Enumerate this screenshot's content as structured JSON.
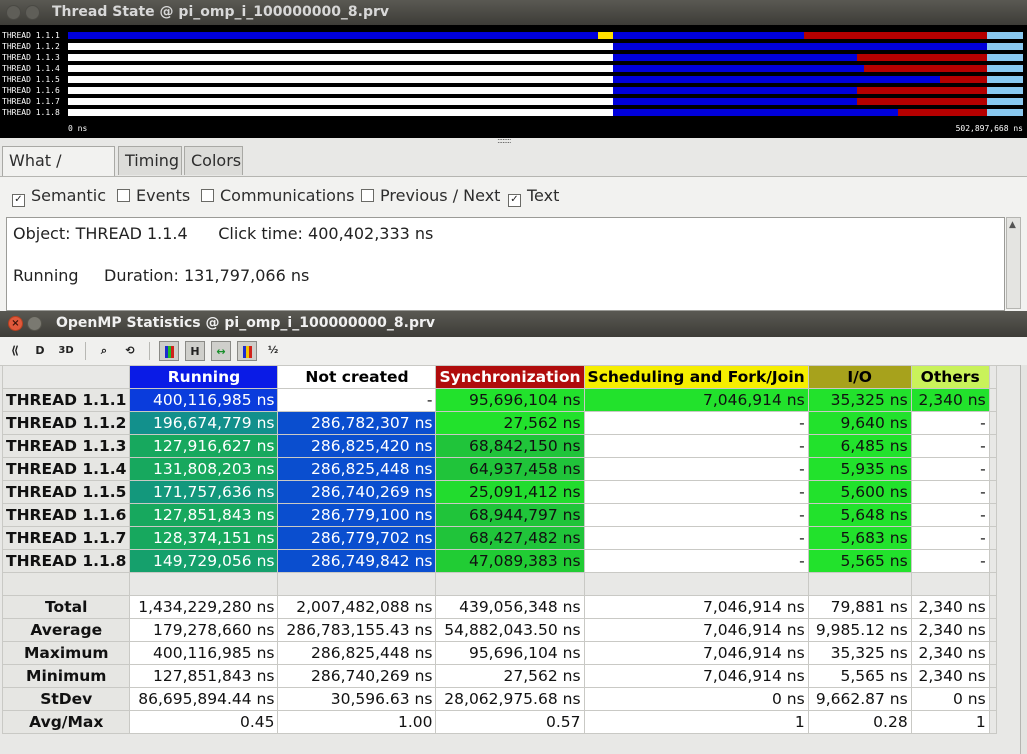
{
  "timeline_window": {
    "title": "Thread State @ pi_omp_i_100000000_8.prv",
    "rows": [
      {
        "label": "THREAD 1.1.1",
        "segments": [
          {
            "from": 0,
            "to": 0.5545,
            "color": "#0000dc"
          },
          {
            "from": 0.5545,
            "to": 0.5705,
            "color": "#ffe000"
          },
          {
            "from": 0.5705,
            "to": 0.7705,
            "color": "#0000dc"
          },
          {
            "from": 0.7705,
            "to": 0.962,
            "color": "#b50000"
          },
          {
            "from": 0.962,
            "to": 1,
            "color": "#89c8f0"
          }
        ]
      },
      {
        "label": "THREAD 1.1.2",
        "segments": [
          {
            "from": 0,
            "to": 0.5705,
            "color": "#ffffff"
          },
          {
            "from": 0.5705,
            "to": 0.962,
            "color": "#0000dc"
          },
          {
            "from": 0.962,
            "to": 1,
            "color": "#89c8f0"
          }
        ]
      },
      {
        "label": "THREAD 1.1.3",
        "segments": [
          {
            "from": 0,
            "to": 0.5705,
            "color": "#ffffff"
          },
          {
            "from": 0.5705,
            "to": 0.826,
            "color": "#0000dc"
          },
          {
            "from": 0.826,
            "to": 0.962,
            "color": "#b50000"
          },
          {
            "from": 0.962,
            "to": 1,
            "color": "#89c8f0"
          }
        ]
      },
      {
        "label": "THREAD 1.1.4",
        "segments": [
          {
            "from": 0,
            "to": 0.5705,
            "color": "#ffffff"
          },
          {
            "from": 0.5705,
            "to": 0.833,
            "color": "#0000dc"
          },
          {
            "from": 0.833,
            "to": 0.962,
            "color": "#b50000"
          },
          {
            "from": 0.962,
            "to": 1,
            "color": "#89c8f0"
          }
        ]
      },
      {
        "label": "THREAD 1.1.5",
        "segments": [
          {
            "from": 0,
            "to": 0.5705,
            "color": "#ffffff"
          },
          {
            "from": 0.5705,
            "to": 0.913,
            "color": "#0000dc"
          },
          {
            "from": 0.913,
            "to": 0.962,
            "color": "#b50000"
          },
          {
            "from": 0.962,
            "to": 1,
            "color": "#89c8f0"
          }
        ]
      },
      {
        "label": "THREAD 1.1.6",
        "segments": [
          {
            "from": 0,
            "to": 0.5705,
            "color": "#ffffff"
          },
          {
            "from": 0.5705,
            "to": 0.826,
            "color": "#0000dc"
          },
          {
            "from": 0.826,
            "to": 0.962,
            "color": "#b50000"
          },
          {
            "from": 0.962,
            "to": 1,
            "color": "#89c8f0"
          }
        ]
      },
      {
        "label": "THREAD 1.1.7",
        "segments": [
          {
            "from": 0,
            "to": 0.5705,
            "color": "#ffffff"
          },
          {
            "from": 0.5705,
            "to": 0.826,
            "color": "#0000dc"
          },
          {
            "from": 0.826,
            "to": 0.962,
            "color": "#b50000"
          },
          {
            "from": 0.962,
            "to": 1,
            "color": "#89c8f0"
          }
        ]
      },
      {
        "label": "THREAD 1.1.8",
        "segments": [
          {
            "from": 0,
            "to": 0.5705,
            "color": "#ffffff"
          },
          {
            "from": 0.5705,
            "to": 0.869,
            "color": "#0000dc"
          },
          {
            "from": 0.869,
            "to": 0.962,
            "color": "#b50000"
          },
          {
            "from": 0.962,
            "to": 1,
            "color": "#89c8f0"
          }
        ]
      }
    ],
    "start_time": "0 ns",
    "end_time": "502,897,668 ns"
  },
  "info_panel": {
    "tabs": [
      "What / Where",
      "Timing",
      "Colors"
    ],
    "active_tab": "What / Where",
    "options": [
      {
        "label": "Semantic",
        "checked": true
      },
      {
        "label": "Events",
        "checked": false
      },
      {
        "label": "Communications",
        "checked": false
      },
      {
        "label": "Previous / Next",
        "checked": false
      },
      {
        "label": "Text",
        "checked": true
      }
    ],
    "text_lines": [
      "Object: THREAD 1.1.4      Click time: 400,402,333 ns",
      "Running     Duration: 131,797,066 ns"
    ]
  },
  "stats_window": {
    "title": "OpenMP Statistics @ pi_omp_i_100000000_8.prv",
    "toolbar": [
      "code-view-icon",
      "data-view-icon",
      "3d-view-icon",
      "zoom-icon",
      "redraw-icon",
      "color-mode-icon",
      "horizontal-icon",
      "hide-empty-icon",
      "semantic-colors-icon",
      "inverse-icon"
    ],
    "columns": [
      {
        "label": "Running",
        "color": "#0a1be6"
      },
      {
        "label": "Not created",
        "color": "#ffffff"
      },
      {
        "label": "Synchronization",
        "color": "#b00c0c"
      },
      {
        "label": "Scheduling and Fork/Join",
        "color": "#f6ee00"
      },
      {
        "label": "I/O",
        "color": "#a7a21c"
      },
      {
        "label": "Others",
        "color": "#c9f25a"
      }
    ],
    "rows": [
      {
        "label": "THREAD 1.1.1",
        "cells": [
          "400,116,985 ns",
          "-",
          "95,696,104 ns",
          "7,046,914 ns",
          "35,325 ns",
          "2,340 ns"
        ],
        "colors": [
          "#0a3cdc",
          "#ffffff",
          "#22e22c",
          "#22e22c",
          "#22e22c",
          "#22e22c"
        ]
      },
      {
        "label": "THREAD 1.1.2",
        "cells": [
          "196,674,779 ns",
          "286,782,307 ns",
          "27,562 ns",
          "-",
          "9,640 ns",
          "-"
        ],
        "colors": [
          "#12908c",
          "#0a4ecf",
          "#22e22c",
          "#ffffff",
          "#22e22c",
          "#ffffff"
        ]
      },
      {
        "label": "THREAD 1.1.3",
        "cells": [
          "127,916,627 ns",
          "286,825,420 ns",
          "68,842,150 ns",
          "-",
          "6,485 ns",
          "-"
        ],
        "colors": [
          "#17a85e",
          "#0a4ecf",
          "#20c43a",
          "#ffffff",
          "#22e22c",
          "#ffffff"
        ]
      },
      {
        "label": "THREAD 1.1.4",
        "cells": [
          "131,808,203 ns",
          "286,825,448 ns",
          "64,937,458 ns",
          "-",
          "5,935 ns",
          "-"
        ],
        "colors": [
          "#17a85e",
          "#0a4ecf",
          "#20c43a",
          "#ffffff",
          "#22e22c",
          "#ffffff"
        ]
      },
      {
        "label": "THREAD 1.1.5",
        "cells": [
          "171,757,636 ns",
          "286,740,269 ns",
          "25,091,412 ns",
          "-",
          "5,600 ns",
          "-"
        ],
        "colors": [
          "#13987c",
          "#0a4ecf",
          "#22dc2e",
          "#ffffff",
          "#22e22c",
          "#ffffff"
        ]
      },
      {
        "label": "THREAD 1.1.6",
        "cells": [
          "127,851,843 ns",
          "286,779,100 ns",
          "68,944,797 ns",
          "-",
          "5,648 ns",
          "-"
        ],
        "colors": [
          "#17a85e",
          "#0a4ecf",
          "#20c43a",
          "#ffffff",
          "#22e22c",
          "#ffffff"
        ]
      },
      {
        "label": "THREAD 1.1.7",
        "cells": [
          "128,374,151 ns",
          "286,779,702 ns",
          "68,427,482 ns",
          "-",
          "5,683 ns",
          "-"
        ],
        "colors": [
          "#17a85e",
          "#0a4ecf",
          "#20c43a",
          "#ffffff",
          "#22e22c",
          "#ffffff"
        ]
      },
      {
        "label": "THREAD 1.1.8",
        "cells": [
          "149,729,056 ns",
          "286,749,842 ns",
          "47,089,383 ns",
          "-",
          "5,565 ns",
          "-"
        ],
        "colors": [
          "#15a06c",
          "#0a4ecf",
          "#21cc34",
          "#ffffff",
          "#22e22c",
          "#ffffff"
        ]
      }
    ],
    "summary": [
      {
        "label": "Total",
        "cells": [
          "1,434,229,280 ns",
          "2,007,482,088 ns",
          "439,056,348 ns",
          "7,046,914 ns",
          "79,881 ns",
          "2,340 ns"
        ]
      },
      {
        "label": "Average",
        "cells": [
          "179,278,660 ns",
          "286,783,155.43 ns",
          "54,882,043.50 ns",
          "7,046,914 ns",
          "9,985.12 ns",
          "2,340 ns"
        ]
      },
      {
        "label": "Maximum",
        "cells": [
          "400,116,985 ns",
          "286,825,448 ns",
          "95,696,104 ns",
          "7,046,914 ns",
          "35,325 ns",
          "2,340 ns"
        ]
      },
      {
        "label": "Minimum",
        "cells": [
          "127,851,843 ns",
          "286,740,269 ns",
          "27,562 ns",
          "7,046,914 ns",
          "5,565 ns",
          "2,340 ns"
        ]
      },
      {
        "label": "StDev",
        "cells": [
          "86,695,894.44 ns",
          "30,596.63 ns",
          "28,062,975.68 ns",
          "0 ns",
          "9,662.87 ns",
          "0 ns"
        ]
      },
      {
        "label": "Avg/Max",
        "cells": [
          "0.45",
          "1.00",
          "0.57",
          "1",
          "0.28",
          "1"
        ]
      }
    ]
  }
}
